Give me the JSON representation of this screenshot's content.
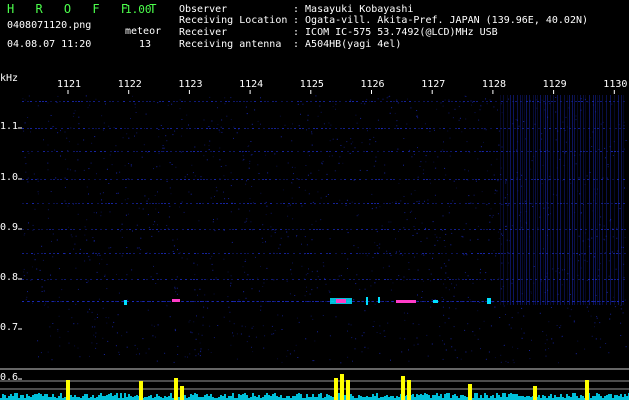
{
  "header": {
    "title": "H R O F F T",
    "version": "1.00",
    "filename": "0408071120.png",
    "datetime": "04.08.07 11:20",
    "meteor_label": "meteor",
    "meteor_count": "13"
  },
  "info": [
    {
      "label": "Observer",
      "value": ": Masayuki Kobayashi"
    },
    {
      "label": "Receiving Location",
      "value": ": Ogata-vill. Akita-Pref. JAPAN (139.96E, 40.02N)"
    },
    {
      "label": "Receiver",
      "value": ": ICOM IC-575 53.7492(@LCD)MHz USB"
    },
    {
      "label": "Receiving antenna",
      "value": ": A504HB(yagi 4el)"
    }
  ],
  "spectrogram": {
    "unit": "kHz",
    "time_ticks": [
      "1121",
      "1122",
      "1123",
      "1124",
      "1125",
      "1126",
      "1127",
      "1128",
      "1129",
      "1130"
    ],
    "freq_ticks": [
      "1.1",
      "1.0",
      "0.9",
      "0.8",
      "0.7",
      "0.6"
    ],
    "colors": {
      "background": "#000000",
      "noise": "#1b2cc8",
      "meteor": "#ff3cc8",
      "echo": "#00e0ff",
      "meter": "#ffff00",
      "meter_line": "#ffffff"
    }
  }
}
